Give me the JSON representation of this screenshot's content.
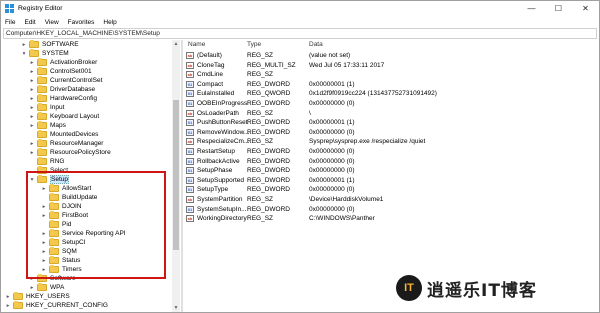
{
  "window": {
    "title": "Registry Editor"
  },
  "menu": [
    "File",
    "Edit",
    "View",
    "Favorites",
    "Help"
  ],
  "address": "Computer\\HKEY_LOCAL_MACHINE\\SYSTEM\\Setup",
  "tree": [
    {
      "label": "SOFTWARE",
      "indent": 1,
      "expander": "▸"
    },
    {
      "label": "SYSTEM",
      "indent": 1,
      "expander": "▾"
    },
    {
      "label": "ActivationBroker",
      "indent": 2,
      "expander": "▸"
    },
    {
      "label": "ControlSet001",
      "indent": 2,
      "expander": "▸"
    },
    {
      "label": "CurrentControlSet",
      "indent": 2,
      "expander": "▸"
    },
    {
      "label": "DriverDatabase",
      "indent": 2,
      "expander": "▸"
    },
    {
      "label": "HardwareConfig",
      "indent": 2,
      "expander": "▸"
    },
    {
      "label": "Input",
      "indent": 2,
      "expander": "▸"
    },
    {
      "label": "Keyboard Layout",
      "indent": 2,
      "expander": "▸"
    },
    {
      "label": "Maps",
      "indent": 2,
      "expander": "▸"
    },
    {
      "label": "MountedDevices",
      "indent": 2,
      "expander": ""
    },
    {
      "label": "ResourceManager",
      "indent": 2,
      "expander": "▸"
    },
    {
      "label": "ResourcePolicyStore",
      "indent": 2,
      "expander": "▸"
    },
    {
      "label": "RNG",
      "indent": 2,
      "expander": ""
    },
    {
      "label": "Select",
      "indent": 2,
      "expander": ""
    },
    {
      "label": "Setup",
      "indent": 2,
      "expander": "▾",
      "selected": true
    },
    {
      "label": "AllowStart",
      "indent": 3,
      "expander": "▸"
    },
    {
      "label": "BuildUpdate",
      "indent": 3,
      "expander": ""
    },
    {
      "label": "DJOIN",
      "indent": 3,
      "expander": "▸"
    },
    {
      "label": "FirstBoot",
      "indent": 3,
      "expander": "▸"
    },
    {
      "label": "Pid",
      "indent": 3,
      "expander": ""
    },
    {
      "label": "Service Reporting API",
      "indent": 3,
      "expander": "▸"
    },
    {
      "label": "SetupCI",
      "indent": 3,
      "expander": "▸"
    },
    {
      "label": "SQM",
      "indent": 3,
      "expander": "▸"
    },
    {
      "label": "Status",
      "indent": 3,
      "expander": "▸"
    },
    {
      "label": "Timers",
      "indent": 3,
      "expander": "▸"
    },
    {
      "label": "Software",
      "indent": 2,
      "expander": "▸"
    },
    {
      "label": "WPA",
      "indent": 2,
      "expander": "▸"
    },
    {
      "label": "HKEY_USERS",
      "indent": 0,
      "expander": "▸"
    },
    {
      "label": "HKEY_CURRENT_CONFIG",
      "indent": 0,
      "expander": "▸"
    }
  ],
  "columns": {
    "name": "Name",
    "type": "Type",
    "data": "Data"
  },
  "values": [
    {
      "icon": "string",
      "icon_text": "ab",
      "name": "(Default)",
      "type": "REG_SZ",
      "data": "(value not set)"
    },
    {
      "icon": "string",
      "icon_text": "ab",
      "name": "CloneTag",
      "type": "REG_MULTI_SZ",
      "data": "Wed Jul 05 17:33:11 2017"
    },
    {
      "icon": "string",
      "icon_text": "ab",
      "name": "CmdLine",
      "type": "REG_SZ",
      "data": ""
    },
    {
      "icon": "binary",
      "icon_text": "01",
      "name": "Compact",
      "type": "REG_DWORD",
      "data": "0x00000001 (1)"
    },
    {
      "icon": "binary",
      "icon_text": "01",
      "name": "EulaInstalled",
      "type": "REG_QWORD",
      "data": "0x1d2f9f0919cc224 (131437752731091492)"
    },
    {
      "icon": "binary",
      "icon_text": "01",
      "name": "OOBEInProgress",
      "type": "REG_DWORD",
      "data": "0x00000000 (0)"
    },
    {
      "icon": "string",
      "icon_text": "ab",
      "name": "OsLoaderPath",
      "type": "REG_SZ",
      "data": "\\"
    },
    {
      "icon": "binary",
      "icon_text": "01",
      "name": "PushButtonReset",
      "type": "REG_DWORD",
      "data": "0x00000001 (1)"
    },
    {
      "icon": "binary",
      "icon_text": "01",
      "name": "RemoveWindow...",
      "type": "REG_DWORD",
      "data": "0x00000000 (0)"
    },
    {
      "icon": "string",
      "icon_text": "ab",
      "name": "RespecializeCm...",
      "type": "REG_SZ",
      "data": "Sysprep\\sysprep.exe /respecialize /quiet"
    },
    {
      "icon": "binary",
      "icon_text": "01",
      "name": "RestartSetup",
      "type": "REG_DWORD",
      "data": "0x00000000 (0)"
    },
    {
      "icon": "binary",
      "icon_text": "01",
      "name": "RollbackActive",
      "type": "REG_DWORD",
      "data": "0x00000000 (0)"
    },
    {
      "icon": "binary",
      "icon_text": "01",
      "name": "SetupPhase",
      "type": "REG_DWORD",
      "data": "0x00000000 (0)"
    },
    {
      "icon": "binary",
      "icon_text": "01",
      "name": "SetupSupported",
      "type": "REG_DWORD",
      "data": "0x00000001 (1)"
    },
    {
      "icon": "binary",
      "icon_text": "01",
      "name": "SetupType",
      "type": "REG_DWORD",
      "data": "0x00000000 (0)"
    },
    {
      "icon": "string",
      "icon_text": "ab",
      "name": "SystemPartition",
      "type": "REG_SZ",
      "data": "\\Device\\HarddiskVolume1"
    },
    {
      "icon": "binary",
      "icon_text": "01",
      "name": "SystemSetupIn...",
      "type": "REG_DWORD",
      "data": "0x00000000 (0)"
    },
    {
      "icon": "string",
      "icon_text": "ab",
      "name": "WorkingDirectory",
      "type": "REG_SZ",
      "data": "C:\\WINDOWS\\Panther"
    }
  ],
  "watermark": {
    "badge": "IT",
    "text": "逍遥乐IT博客"
  },
  "colors": {
    "selection": "#cce8ff",
    "highlight_box": "#d01515",
    "folder": "#f2c94c"
  }
}
